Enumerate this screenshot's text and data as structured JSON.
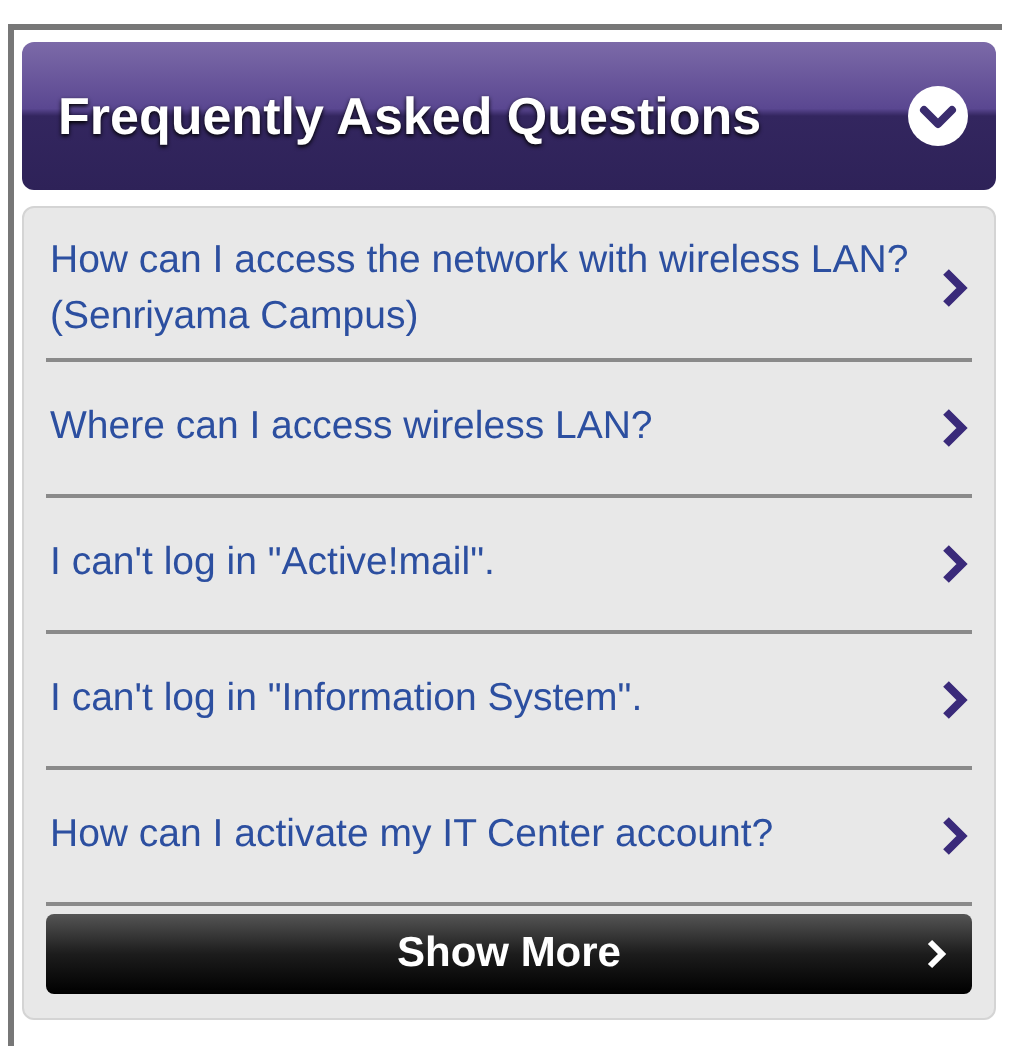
{
  "header": {
    "title": "Frequently Asked Questions",
    "expanded": true
  },
  "questions": [
    {
      "text": "How can I access the network with wireless LAN?(Senriyama Campus)"
    },
    {
      "text": "Where can I access wireless LAN?"
    },
    {
      "text": "I can't log in \"Active!mail\"."
    },
    {
      "text": "I can't log in \"Information System\"."
    },
    {
      "text": "How can I activate my IT Center account?"
    }
  ],
  "more_button": {
    "label": "Show More"
  }
}
